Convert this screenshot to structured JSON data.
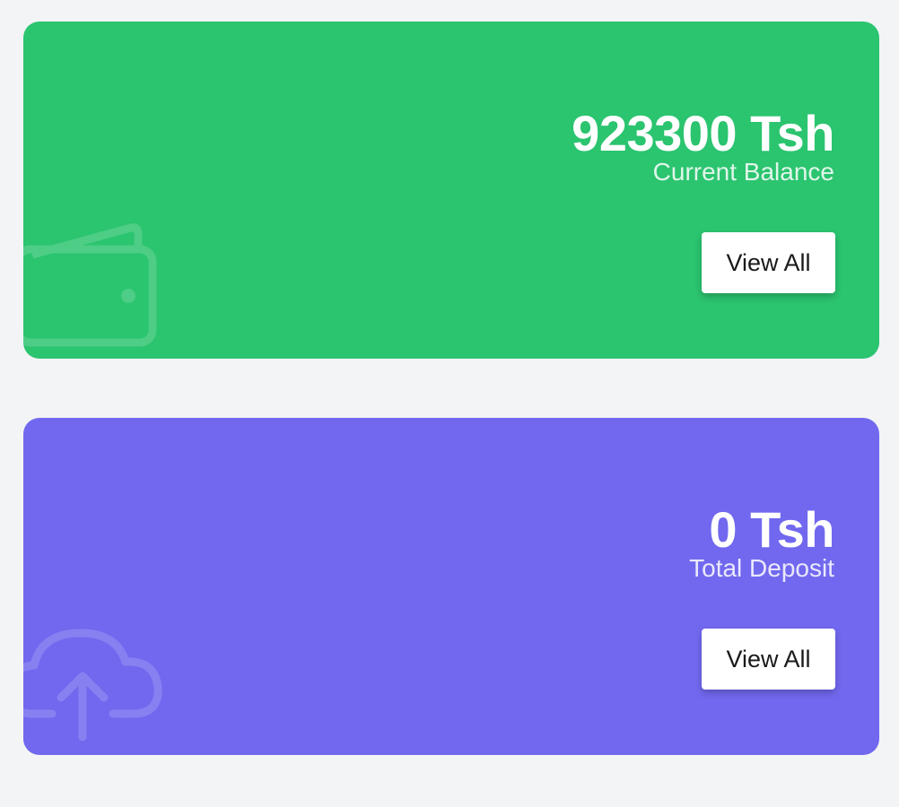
{
  "colors": {
    "page_background": "#f3f4f6",
    "balance_card": "#2bc46f",
    "deposit_card": "#7168ef",
    "button_background": "#ffffff"
  },
  "cards": [
    {
      "amount": "923300 Tsh",
      "caption": "Current Balance",
      "button_label": "View All",
      "icon": "wallet-icon"
    },
    {
      "amount": "0 Tsh",
      "caption": "Total Deposit",
      "button_label": "View All",
      "icon": "cloud-upload-icon"
    }
  ]
}
